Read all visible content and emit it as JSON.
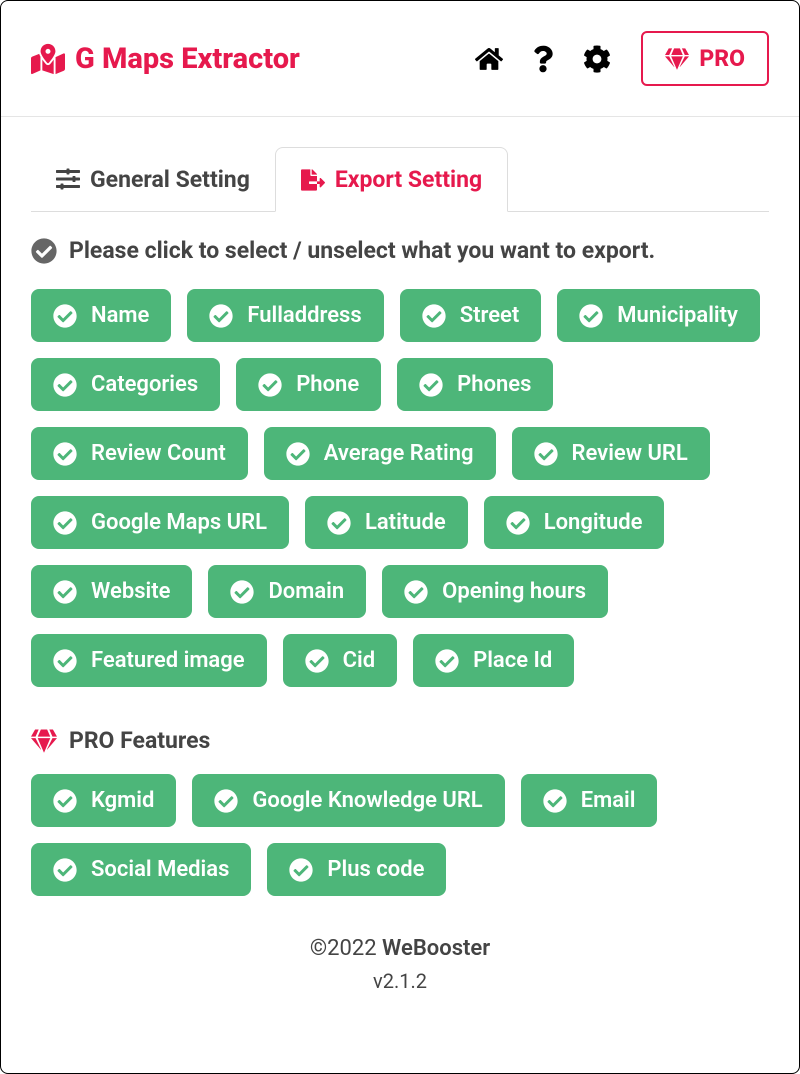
{
  "header": {
    "title": "G Maps Extractor",
    "pro_label": "PRO"
  },
  "tabs": {
    "general": "General Setting",
    "export": "Export Setting"
  },
  "instruction": "Please click to select / unselect what you want to export.",
  "export_fields": [
    "Name",
    "Fulladdress",
    "Street",
    "Municipality",
    "Categories",
    "Phone",
    "Phones",
    "Review Count",
    "Average Rating",
    "Review URL",
    "Google Maps URL",
    "Latitude",
    "Longitude",
    "Website",
    "Domain",
    "Opening hours",
    "Featured image",
    "Cid",
    "Place Id"
  ],
  "pro_section_title": "PRO Features",
  "pro_fields": [
    "Kgmid",
    "Google Knowledge URL",
    "Email",
    "Social Medias",
    "Plus code"
  ],
  "footer": {
    "copyright": "©2022 ",
    "company": "WeBooster",
    "version": "v2.1.2"
  }
}
